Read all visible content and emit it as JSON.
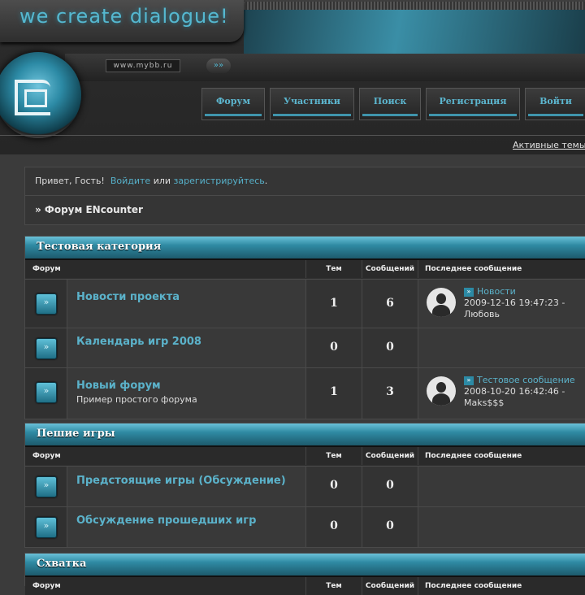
{
  "header": {
    "logo_text": "we create dialogue!",
    "url_text": "www.mybb.ru",
    "go_icon": "double-chevron-right-icon",
    "menu": [
      "Форум",
      "Участники",
      "Поиск",
      "Регистрация",
      "Войти"
    ],
    "active_topics": "Активные темы"
  },
  "welcome": {
    "greeting": "Привет, Гость!",
    "login": "Войдите",
    "or": "или",
    "register": "зарегистрируйтесь",
    "period": ".",
    "breadcrumb": "» Форум ENcounter"
  },
  "columns": {
    "forum": "Форум",
    "topics": "Тем",
    "posts": "Сообщений",
    "last": "Последнее сообщение"
  },
  "categories": [
    {
      "title": "Тестовая категория",
      "forums": [
        {
          "name": "Новости проекта",
          "desc": "",
          "topics": "1",
          "posts": "6",
          "last_title": "Новости",
          "last_date": "2009-12-16 19:47:23 -",
          "last_author": "Любовь"
        },
        {
          "name": "Календарь игр 2008",
          "desc": "",
          "topics": "0",
          "posts": "0"
        },
        {
          "name": "Новый форум",
          "desc": "Пример простого форума",
          "topics": "1",
          "posts": "3",
          "last_title": "Тестовое сообщение",
          "last_date": "2008-10-20 16:42:46 -",
          "last_author": "Maks$$$"
        }
      ]
    },
    {
      "title": "Пешие игры",
      "forums": [
        {
          "name": "Предстоящие игры (Обсуждение)",
          "desc": "",
          "topics": "0",
          "posts": "0"
        },
        {
          "name": "Обсуждение прошедших игр",
          "desc": "",
          "topics": "0",
          "posts": "0"
        }
      ]
    },
    {
      "title": "Схватка",
      "forums": []
    }
  ],
  "colors": {
    "accent": "#5bb2ca",
    "band": "#2f8aa3",
    "background": "#3b3b3b"
  }
}
